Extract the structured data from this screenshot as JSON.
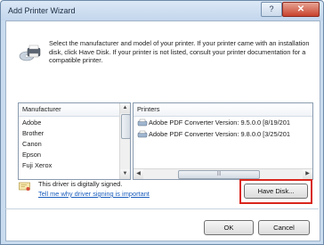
{
  "window": {
    "title": "Add Printer Wizard",
    "help_btn": "?",
    "close_btn": "✕"
  },
  "header": {
    "description": "Select the manufacturer and model of your printer. If your printer came with an installation disk, click Have Disk. If your printer is not listed, consult your printer documentation for a compatible printer.",
    "icon": "printer-cd-icon"
  },
  "manufacturer_list": {
    "header": "Manufacturer",
    "items": [
      "Adobe",
      "Brother",
      "Canon",
      "Epson",
      "Fuji Xerox"
    ]
  },
  "printers_list": {
    "header": "Printers",
    "items": [
      "Adobe PDF Converter Version: 9.5.0.0 [8/19/201",
      "Adobe PDF Converter Version: 9.8.0.0 [3/25/201"
    ],
    "hscroll_grip": "|||"
  },
  "driver": {
    "signed_text": "This driver is digitally signed.",
    "link_text": "Tell me why driver signing is important",
    "icon": "certificate-icon"
  },
  "buttons": {
    "have_disk": "Have Disk...",
    "ok": "OK",
    "cancel": "Cancel"
  },
  "colors": {
    "highlight_border": "#d9261c",
    "link": "#1a5dbd",
    "close_button": "#c8422d"
  }
}
